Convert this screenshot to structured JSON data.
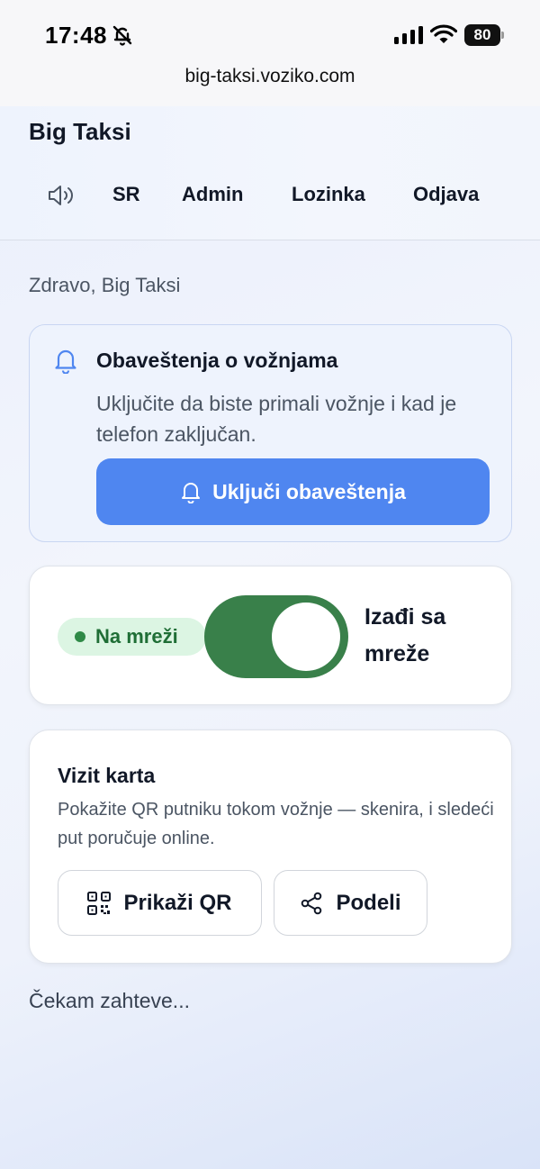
{
  "status_bar": {
    "time": "17:48",
    "battery": "80",
    "icons": [
      "bell-off-icon",
      "signal-icon",
      "wifi-icon",
      "battery-icon"
    ]
  },
  "browser": {
    "url": "big-taksi.voziko.com"
  },
  "header": {
    "title": "Big Taksi",
    "nav": {
      "sound_icon": "speaker-icon",
      "language": "SR",
      "admin": "Admin",
      "password": "Lozinka",
      "logout": "Odjava"
    }
  },
  "greeting": "Zdravo, Big Taksi",
  "notifications": {
    "title": "Obaveštenja o vožnjama",
    "description": "Uključite da biste primali vožnje i kad je telefon zaključan.",
    "button_label": "Uključi obaveštenja",
    "accent": "#4f86f0"
  },
  "online": {
    "status_label": "Na mreži",
    "toggle_on": true,
    "toggle_label": "Izađi sa mreže",
    "toggle_color": "#39804a"
  },
  "business_card": {
    "title": "Vizit karta",
    "description": "Pokažite QR putniku tokom vožnje — skenira, i sledeći put poručuje online.",
    "show_qr_label": "Prikaži QR",
    "share_label": "Podeli"
  },
  "waiting_text": "Čekam zahteve..."
}
